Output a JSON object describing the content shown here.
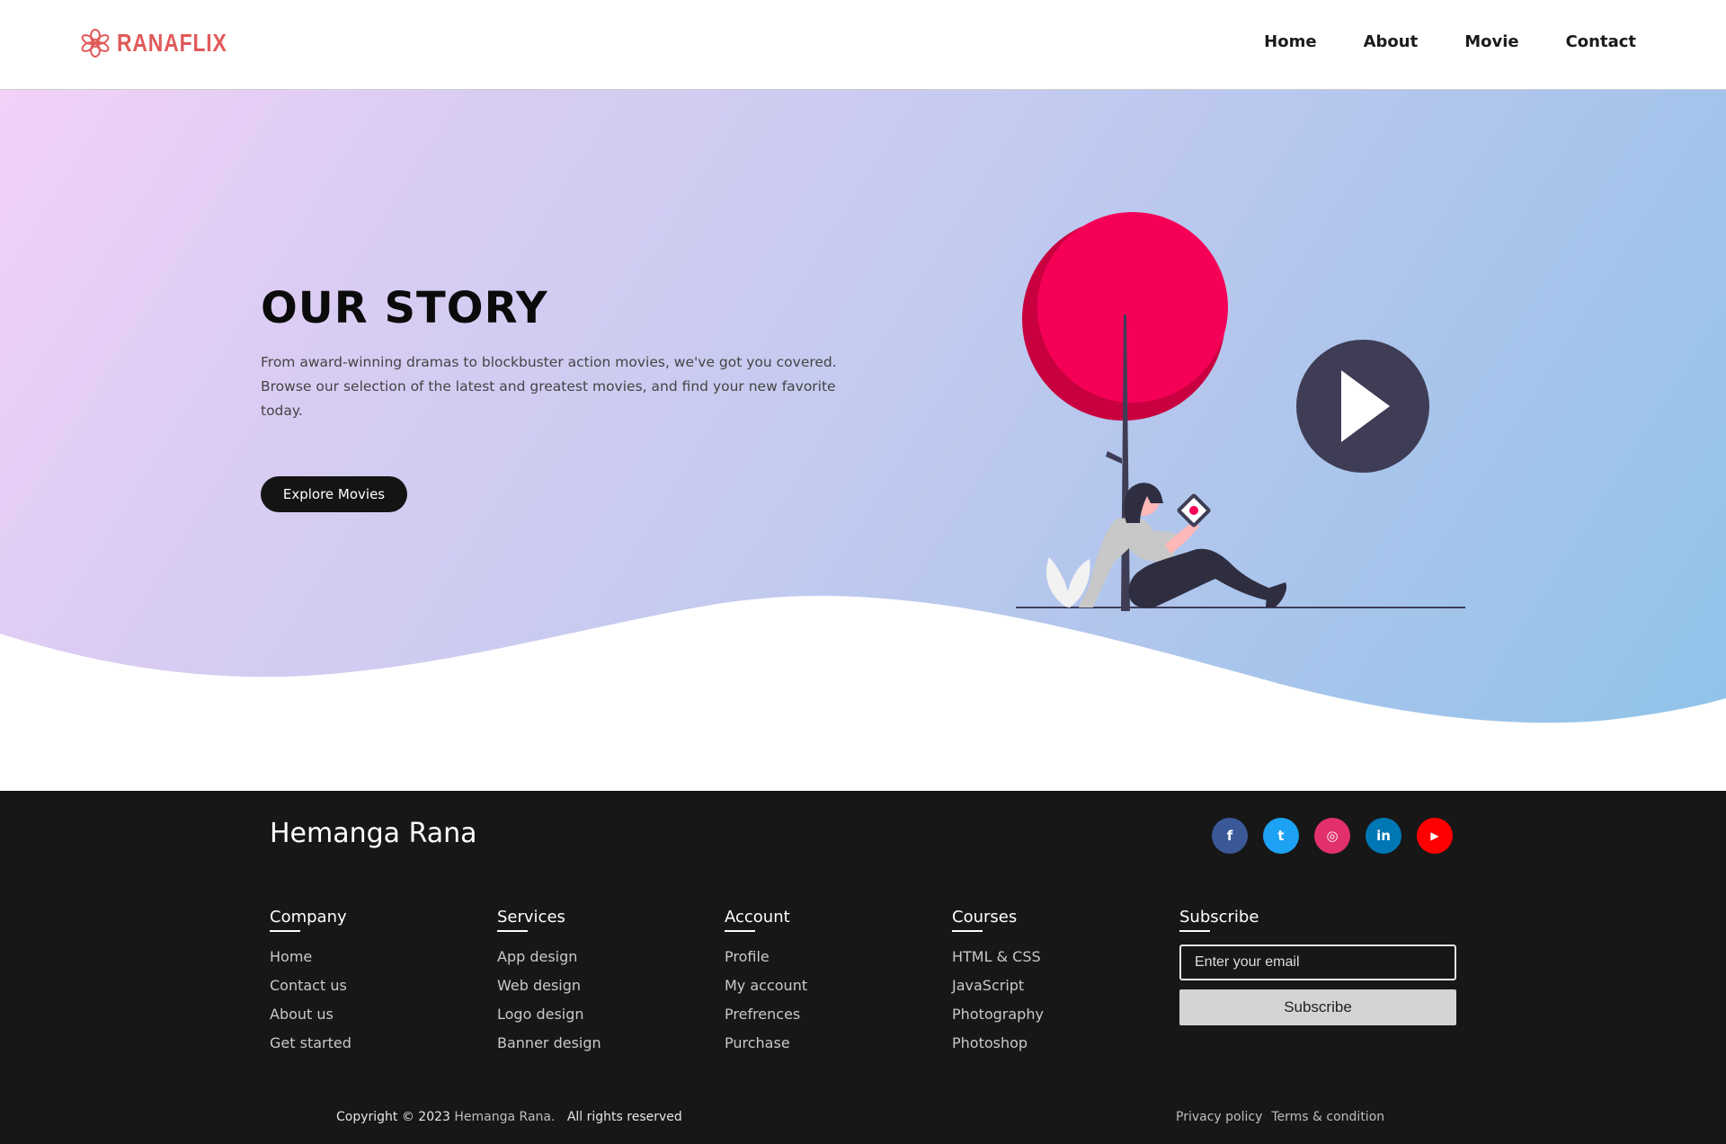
{
  "header": {
    "logo_text": "RANAFLIX",
    "nav": [
      "Home",
      "About",
      "Movie",
      "Contact"
    ]
  },
  "hero": {
    "title": "OUR STORY",
    "description": "From award-winning dramas to blockbuster action movies, we've got you covered. Browse our selection of the latest and greatest movies, and find your new favorite today.",
    "button_label": "Explore Movies",
    "illustration": "woman-with-tablet-under-tree-play-icon"
  },
  "footer": {
    "brand": "Hemanga Rana",
    "socials": [
      {
        "name": "facebook",
        "glyph": "f",
        "color": "#3b5998"
      },
      {
        "name": "twitter",
        "glyph": "t",
        "color": "#1da1f2"
      },
      {
        "name": "instagram",
        "glyph": "◎",
        "color": "#e1306c"
      },
      {
        "name": "linkedin",
        "glyph": "in",
        "color": "#0077b5"
      },
      {
        "name": "youtube",
        "glyph": "▶",
        "color": "#ff0000"
      }
    ],
    "columns": [
      {
        "title": "Company",
        "items": [
          "Home",
          "Contact us",
          "About us",
          "Get started"
        ]
      },
      {
        "title": "Services",
        "items": [
          "App design",
          "Web design",
          "Logo design",
          "Banner design"
        ]
      },
      {
        "title": "Account",
        "items": [
          "Profile",
          "My account",
          "Prefrences",
          "Purchase"
        ]
      },
      {
        "title": "Courses",
        "items": [
          "HTML & CSS",
          "JavaScript",
          "Photography",
          "Photoshop"
        ]
      }
    ],
    "subscribe": {
      "title": "Subscribe",
      "placeholder": "Enter your email",
      "button_label": "Subscribe"
    },
    "copyright_prefix": "Copyright © 2023",
    "copyright_name": "Hemanga Rana.",
    "copyright_suffix": "All rights reserved",
    "legal": [
      "Privacy policy",
      "Terms & condition"
    ]
  },
  "colors": {
    "accent": "#e05a5a",
    "tree": "#f50057",
    "play": "#3f3d56",
    "footer_bg": "#171717"
  }
}
